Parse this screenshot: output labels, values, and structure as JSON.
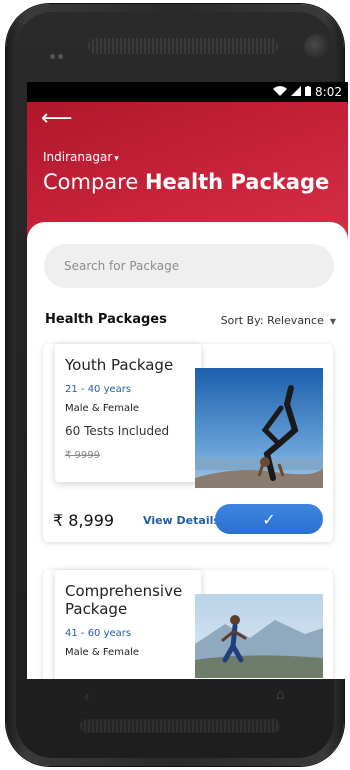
{
  "status": {
    "time": "8:02"
  },
  "header": {
    "location": "Indiranagar",
    "title_light": "Compare",
    "title_bold": "Health Package"
  },
  "search": {
    "placeholder": "Search for Package"
  },
  "list": {
    "section_title": "Health Packages",
    "sort_label": "Sort By: Relevance"
  },
  "packages": [
    {
      "name": "Youth Package",
      "age_range": "21 - 40 years",
      "gender": "Male & Female",
      "tests": "60 Tests Included",
      "old_price": "₹ 9999",
      "price": "₹ 8,999",
      "details_label": "View Details",
      "selected": true,
      "select_icon": "check-icon"
    },
    {
      "name": "Comprehensive Package",
      "age_range": "41 - 60 years",
      "gender": "Male & Female"
    }
  ],
  "colors": {
    "brand_red": "#c9243b",
    "accent_blue": "#2b6fd0",
    "link_blue": "#1f5ea8"
  }
}
